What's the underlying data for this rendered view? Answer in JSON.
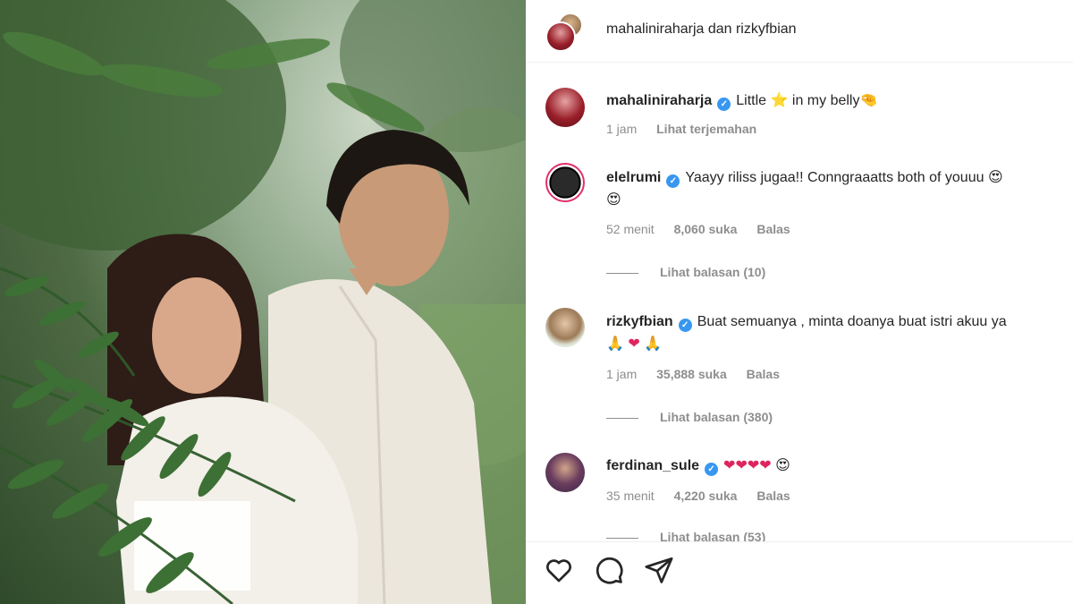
{
  "header": {
    "title": "mahaliniraharja dan rizkyfbian"
  },
  "caption": {
    "username": "mahaliniraharja",
    "text_before": "Little",
    "emoji_star": "⭐",
    "text_after": "in my belly",
    "emoji_hand": "🤏",
    "time": "1 jam",
    "translate": "Lihat terjemahan"
  },
  "comments": [
    {
      "username": "elelrumi",
      "text": "Yaayy riliss jugaa!! Conngraaatts both of youuu",
      "emoji": "😍",
      "emoji_line2": "😍",
      "time": "52 menit",
      "likes": "8,060 suka",
      "reply": "Balas",
      "view_replies": "Lihat balasan (10)"
    },
    {
      "username": "rizkyfbian",
      "text": "Buat semuanya , minta doanya buat istri akuu ya",
      "emoji_line2_a": "🙏",
      "emoji_line2_b": "❤",
      "emoji_line2_c": "🙏",
      "time": "1 jam",
      "likes": "35,888 suka",
      "reply": "Balas",
      "view_replies": "Lihat balasan (380)"
    },
    {
      "username": "ferdinan_sule",
      "text": "❤❤❤❤",
      "emoji": "😍",
      "time": "35 menit",
      "likes": "4,220 suka",
      "reply": "Balas",
      "view_replies": "Lihat balasan (53)"
    }
  ],
  "icons": {
    "verified": "✓",
    "like": "heart-icon",
    "comment": "comment-icon",
    "share": "send-icon"
  },
  "colors": {
    "verified": "#3897f0",
    "muted": "#8e8e8e",
    "text": "#262626"
  }
}
